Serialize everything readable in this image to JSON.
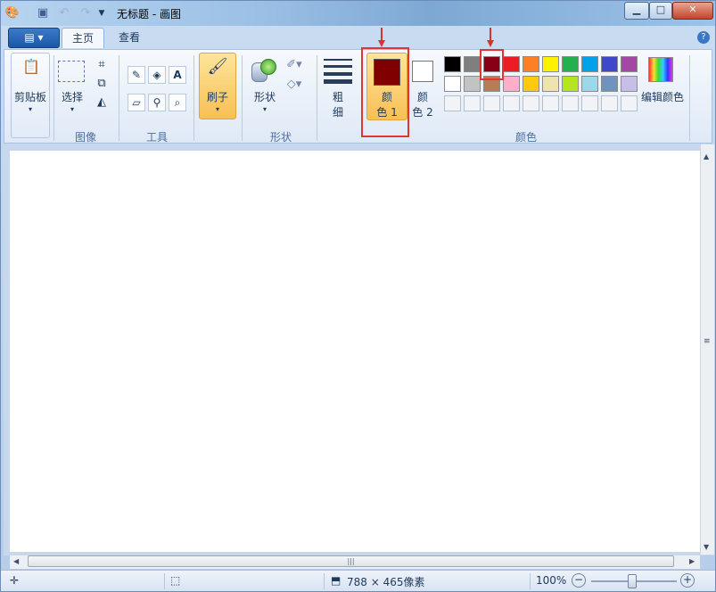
{
  "window": {
    "title": "无标题 - 画图"
  },
  "tabs": {
    "home": "主页",
    "view": "查看"
  },
  "groups": {
    "clipboard": {
      "label": "剪贴板"
    },
    "image": {
      "label": "图像",
      "select": "选择"
    },
    "tools": {
      "label": "工具"
    },
    "brushes": {
      "label": "刷子"
    },
    "shapes": {
      "label": "形状",
      "shapes_btn": "形状"
    },
    "size": {
      "line1": "粗",
      "line2": "细"
    },
    "colors": {
      "label": "颜色",
      "color1_line1": "颜",
      "color1_line2": "色 1",
      "color2_line1": "颜",
      "color2_line2": "色 2",
      "edit_colors": "编辑颜色",
      "color1_value": "#800000",
      "color2_value": "#ffffff",
      "palette_row1": [
        "#000000",
        "#7f7f7f",
        "#880015",
        "#ed1c24",
        "#ff7f27",
        "#fff200",
        "#22b14c",
        "#00a2e8",
        "#3f48cc",
        "#a349a4"
      ],
      "palette_row2": [
        "#ffffff",
        "#c3c3c3",
        "#b97a57",
        "#ffaec9",
        "#ffc90e",
        "#efe4b0",
        "#b5e61d",
        "#99d9ea",
        "#7092be",
        "#c8bfe7"
      ]
    }
  },
  "status": {
    "dimensions": "788 × 465像素",
    "zoom": "100%"
  },
  "annotations": {
    "highlight_color": "#e03530"
  }
}
